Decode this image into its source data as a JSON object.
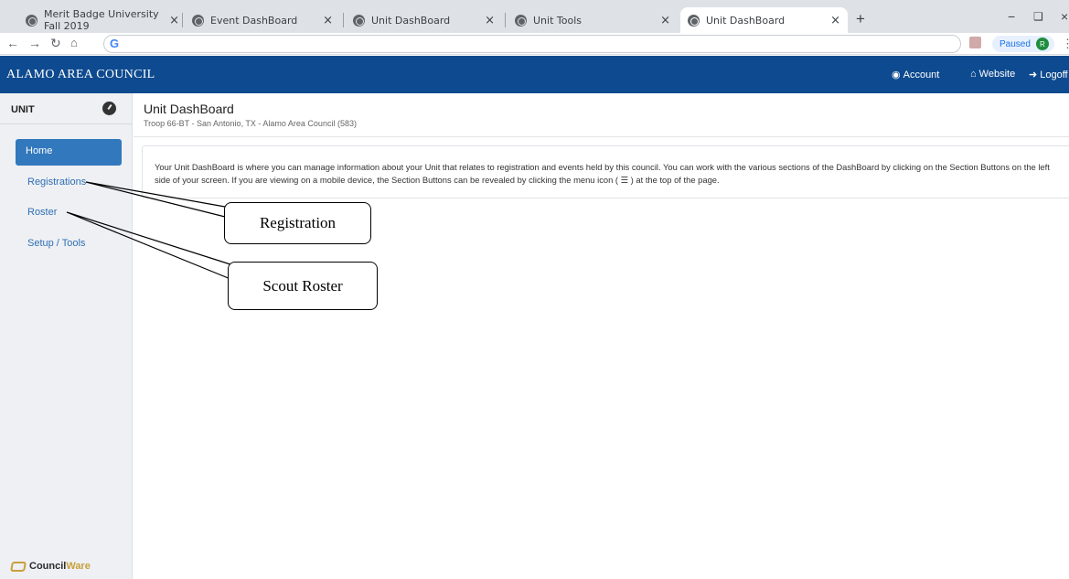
{
  "browser": {
    "tabs": [
      {
        "title": "Merit Badge University Fall 2019",
        "active": false
      },
      {
        "title": "Event DashBoard",
        "active": false
      },
      {
        "title": "Unit DashBoard",
        "active": false
      },
      {
        "title": "Unit Tools",
        "active": false
      },
      {
        "title": "Unit DashBoard",
        "active": true
      }
    ],
    "close_glyph": "×",
    "new_tab_glyph": "+",
    "paused_label": "Paused",
    "profile_initial": "R"
  },
  "appbar": {
    "brand": "ALAMO AREA COUNCIL",
    "links": [
      {
        "label": "Account",
        "icon": "user-circle-icon"
      },
      {
        "label": "Website",
        "icon": "home-icon"
      },
      {
        "label": "Logoff",
        "icon": "sign-out-icon"
      }
    ]
  },
  "sidebar": {
    "header": "UNIT",
    "items": [
      {
        "label": "Home",
        "active": true
      },
      {
        "label": "Registrations",
        "active": false
      },
      {
        "label": "Roster",
        "active": false
      },
      {
        "label": "Setup / Tools",
        "active": false
      }
    ],
    "footer": {
      "brand_a": "Council",
      "brand_b": "Ware"
    }
  },
  "main": {
    "title": "Unit DashBoard",
    "subtitle": "Troop 66-BT - San Antonio, TX - Alamo Area Council (583)",
    "info": "Your Unit DashBoard is where you can manage information about your Unit that relates to registration and events held by this council. You can work with the various sections of the DashBoard by clicking on the Section Buttons on the left side of your screen. If you are viewing on a mobile device, the Section Buttons can be revealed by clicking the menu icon ( ☰ ) at the top of the page."
  },
  "callouts": {
    "registration": "Registration",
    "roster": "Scout Roster"
  },
  "colors": {
    "appbar": "#0e4a8f",
    "active_item": "#3278bd",
    "link": "#2f6fb5"
  }
}
